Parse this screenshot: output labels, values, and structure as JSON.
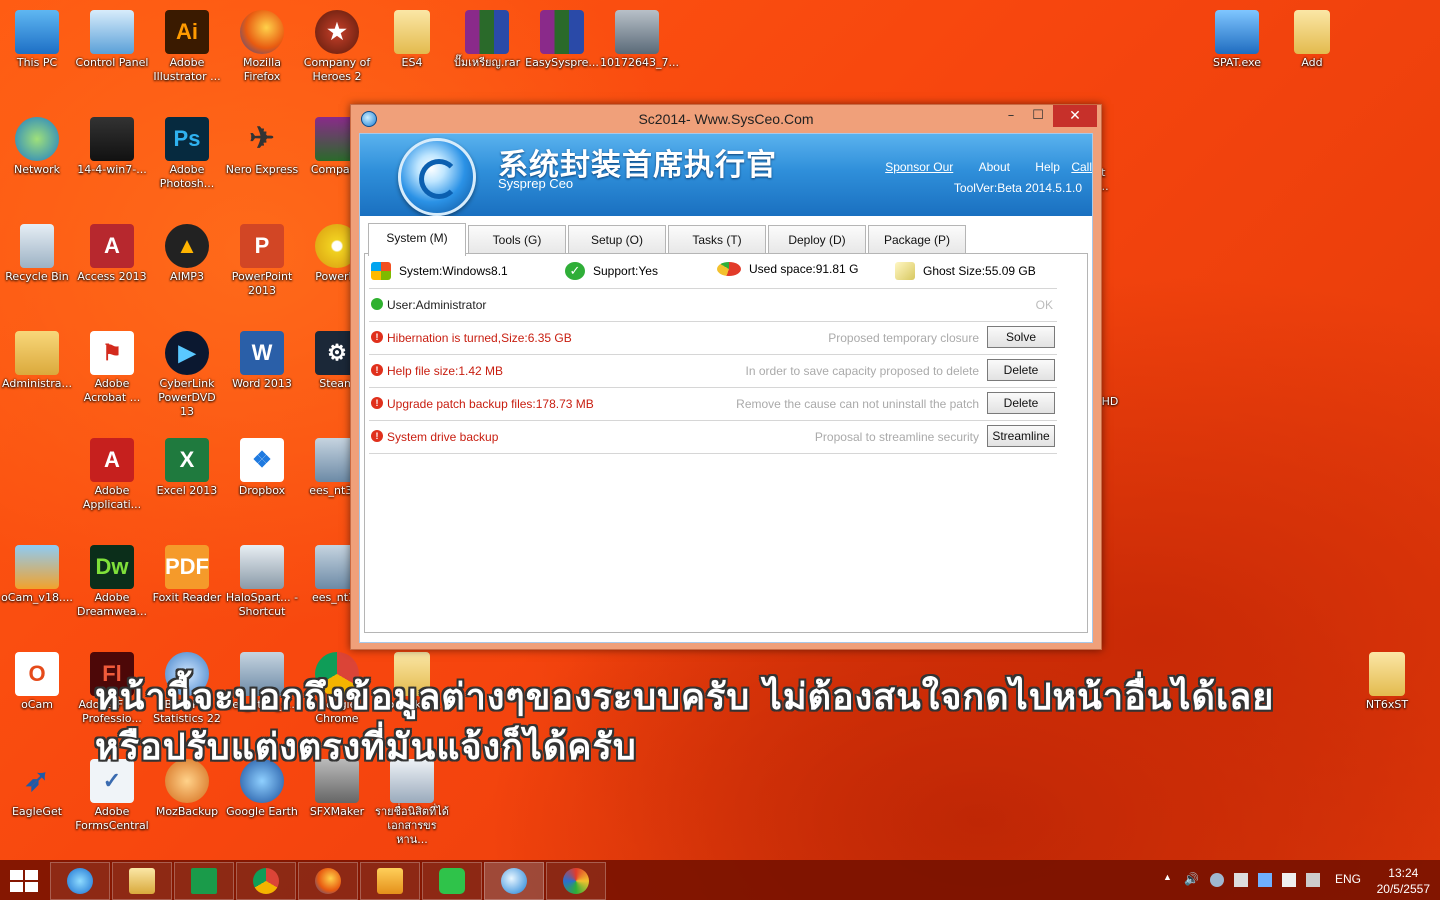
{
  "desktop": {
    "icons": [
      {
        "id": "this-pc",
        "label": "This PC"
      },
      {
        "id": "control-panel",
        "label": "Control Panel"
      },
      {
        "id": "adobe-illustrator",
        "label": "Adobe Illustrator ..."
      },
      {
        "id": "mozilla-firefox",
        "label": "Mozilla Firefox"
      },
      {
        "id": "company-of-heroes-2",
        "label": "Company of Heroes 2"
      },
      {
        "id": "es4",
        "label": "ES4"
      },
      {
        "id": "rar-file",
        "label": "ปั๊มเหรียญ.rar"
      },
      {
        "id": "easysyspre",
        "label": "EasySyspre..."
      },
      {
        "id": "img-10172643",
        "label": "10172643_7..."
      },
      {
        "id": "spat-exe",
        "label": "SPAT.exe"
      },
      {
        "id": "add-folder",
        "label": "Add"
      },
      {
        "id": "network",
        "label": "Network"
      },
      {
        "id": "win7",
        "label": "14-4-win7-..."
      },
      {
        "id": "adobe-photoshop",
        "label": "Adobe Photosh..."
      },
      {
        "id": "nero-express",
        "label": "Nero Express"
      },
      {
        "id": "company",
        "label": "Company"
      },
      {
        "id": "recycle-bin",
        "label": "Recycle Bin"
      },
      {
        "id": "access-2013",
        "label": "Access 2013"
      },
      {
        "id": "aimp3",
        "label": "AIMP3"
      },
      {
        "id": "powerpoint-2013",
        "label": "PowerPoint 2013"
      },
      {
        "id": "powers",
        "label": "PowerIS"
      },
      {
        "id": "administrator",
        "label": "Administra..."
      },
      {
        "id": "adobe-acrobat",
        "label": "Adobe Acrobat ..."
      },
      {
        "id": "cyberlink",
        "label": "CyberLink PowerDVD 13"
      },
      {
        "id": "word-2013",
        "label": "Word 2013"
      },
      {
        "id": "steam",
        "label": "Steam"
      },
      {
        "id": "adobe-application",
        "label": "Adobe Applicati..."
      },
      {
        "id": "excel-2013",
        "label": "Excel 2013"
      },
      {
        "id": "dropbox",
        "label": "Dropbox"
      },
      {
        "id": "ees-nt32-a",
        "label": "ees_nt32_"
      },
      {
        "id": "ocam-v18",
        "label": "oCam_v18...."
      },
      {
        "id": "adobe-dreamweaver",
        "label": "Adobe Dreamwea..."
      },
      {
        "id": "foxit-reader",
        "label": "Foxit Reader"
      },
      {
        "id": "halospartan",
        "label": "HaloSpart... - Shortcut"
      },
      {
        "id": "ees-nt32-b",
        "label": "ees_nt32"
      },
      {
        "id": "ocam",
        "label": "oCam"
      },
      {
        "id": "adobe-flash",
        "label": "Adobe Flash Professio..."
      },
      {
        "id": "ibm-spss",
        "label": "IBM SPSS Statistics 22"
      },
      {
        "id": "ees-nt64",
        "label": "ees_nt64_e..."
      },
      {
        "id": "google-chrome",
        "label": "Google Chrome"
      },
      {
        "id": "toudakai",
        "label": "Toudakai..."
      },
      {
        "id": "nt6xst",
        "label": "NT6xST"
      },
      {
        "id": "eagleget",
        "label": "EagleGet"
      },
      {
        "id": "adobe-formscentral",
        "label": "Adobe FormsCentral"
      },
      {
        "id": "mozbackup",
        "label": "MozBackup"
      },
      {
        "id": "google-earth",
        "label": "Google Earth"
      },
      {
        "id": "sfxmaker",
        "label": "SFXMaker"
      },
      {
        "id": "thai-doc",
        "label": "รายชื่อนิสิตที่ได้ เอกสารขรหาน..."
      }
    ],
    "partial_labels": {
      "xt": "xt",
      "e": "e...",
      "hd": "HD"
    }
  },
  "window": {
    "title": "Sc2014- Www.SysCeo.Com",
    "min_glyph": "–",
    "max_glyph": "☐",
    "close_glyph": "✕",
    "banner": {
      "cn_title": "系统封装首席执行官",
      "en_title": "Sysprep  Ceo",
      "links": {
        "sponsor": "Sponsor Our",
        "about": "About",
        "help": "Help",
        "call": "Call"
      },
      "version": "ToolVer:Beta 2014.5.1.0"
    },
    "tabs": [
      "System (M)",
      "Tools (G)",
      "Setup (O)",
      "Tasks (T)",
      "Deploy (D)",
      "Package (P)"
    ],
    "sysinfo": {
      "system": "System:Windows8.1",
      "support": "Support:Yes",
      "used": "Used space:91.81 G",
      "ghost": "Ghost Size:55.09 GB"
    },
    "rows": [
      {
        "text": "User:Administrator",
        "hint": "",
        "status": "OK",
        "action": ""
      },
      {
        "text": "Hibernation is turned,Size:6.35 GB",
        "hint": "Proposed temporary closure",
        "status": "",
        "action": "Solve"
      },
      {
        "text": "Help file size:1.42 MB",
        "hint": "In order to save capacity proposed to delete",
        "status": "",
        "action": "Delete"
      },
      {
        "text": "Upgrade patch backup files:178.73 MB",
        "hint": "Remove the cause can not uninstall the patch",
        "status": "",
        "action": "Delete"
      },
      {
        "text": "System drive backup",
        "hint": "Proposal to streamline security",
        "status": "",
        "action": "Streamline"
      }
    ],
    "warn_glyph": "!"
  },
  "caption": {
    "line1": "หน้านี้จะบอกถึงข้อมูลต่างๆของระบบครับ ไม่ต้องสนใจกดไปหน้าอื่นได้เลย",
    "line2": "หรือปรับแต่งตรงที่มันแจ้งก็ได้ครับ"
  },
  "taskbar": {
    "lang": "ENG",
    "time": "13:24",
    "date": "20/5/2557",
    "tray_arrow": "▲",
    "tray_volume": "🔊"
  }
}
